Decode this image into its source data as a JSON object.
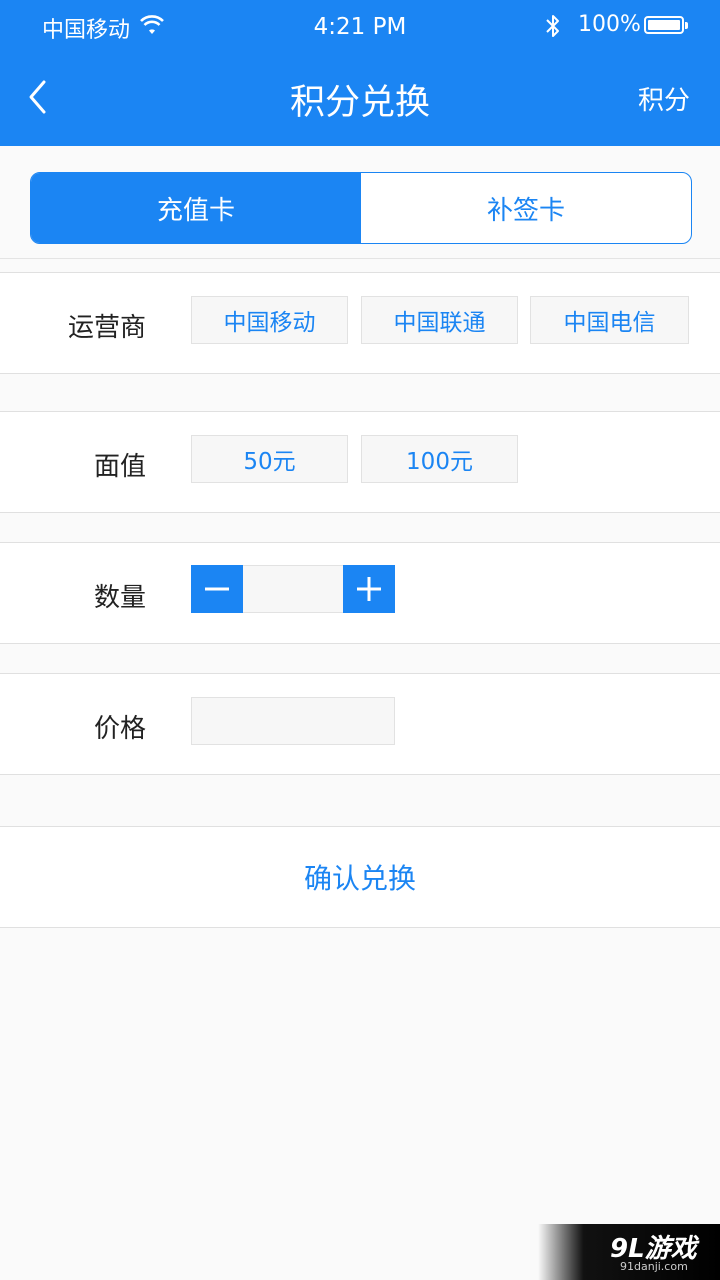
{
  "status_bar": {
    "carrier": "中国移动",
    "time": "4:21 PM",
    "battery": "100%",
    "battery_level": 1.0
  },
  "nav": {
    "title": "积分兑换",
    "right_label": "积分",
    "back_icon": "chevron-left-icon"
  },
  "tabs": [
    {
      "label": "充值卡",
      "active": true
    },
    {
      "label": "补签卡",
      "active": false
    }
  ],
  "form": {
    "operator": {
      "label": "运营商",
      "options": [
        "中国移动",
        "中国联通",
        "中国电信"
      ]
    },
    "face_value": {
      "label": "面值",
      "options": [
        "50元",
        "100元"
      ]
    },
    "quantity": {
      "label": "数量",
      "value": ""
    },
    "price": {
      "label": "价格",
      "value": ""
    }
  },
  "confirm_label": "确认兑换",
  "watermark": {
    "brand": "9L游戏",
    "url": "91danji.com"
  },
  "colors": {
    "accent": "#1b85f3",
    "background": "#fafafa"
  }
}
